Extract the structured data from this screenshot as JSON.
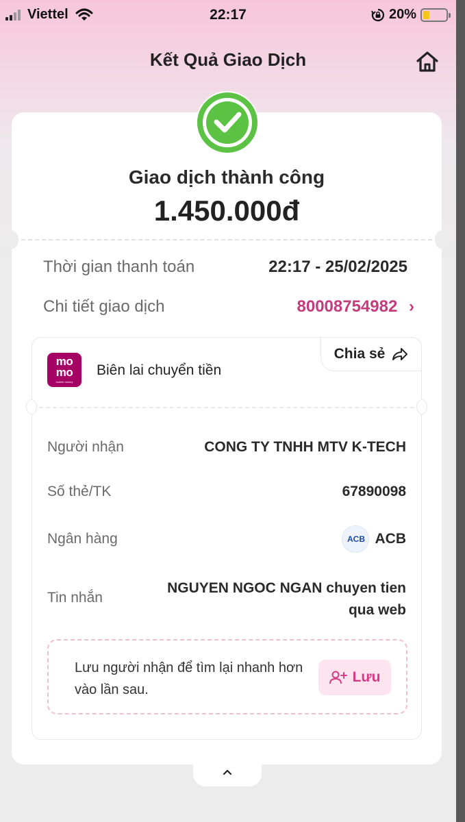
{
  "status_bar": {
    "carrier": "Viettel",
    "time": "22:17",
    "battery_percent": "20%",
    "battery_level": 0.2
  },
  "header": {
    "title": "Kết Quả Giao Dịch",
    "home_icon": "home-icon"
  },
  "result": {
    "status": "Giao dịch thành công",
    "amount": "1.450.000đ",
    "icon": "check-circle-icon",
    "icon_color": "#5cc243"
  },
  "details": {
    "time_label": "Thời gian thanh toán",
    "time_value": "22:17 - 25/02/2025",
    "detail_label": "Chi tiết giao dịch",
    "detail_value": "80008754982",
    "accent_color": "#c43b7e"
  },
  "receipt": {
    "logo_text_1": "mo",
    "logo_text_2": "mo",
    "logo_caption": "mobile money",
    "logo_color": "#a50064",
    "title": "Biên lai chuyển tiền",
    "share_label": "Chia sẻ",
    "rows": [
      {
        "label": "Người nhận",
        "value": "CONG TY TNHH MTV K-TECH"
      },
      {
        "label": "Số thẻ/TK",
        "value": "67890098"
      },
      {
        "label": "Ngân hàng",
        "value": "ACB",
        "logo": "ACB"
      },
      {
        "label": "Tin nhắn",
        "value": "NGUYEN NGOC NGAN chuyen tien qua web"
      }
    ]
  },
  "save_recipient": {
    "text": "Lưu người nhận để tìm lại nhanh hơn vào lần sau.",
    "button_label": "Lưu"
  }
}
